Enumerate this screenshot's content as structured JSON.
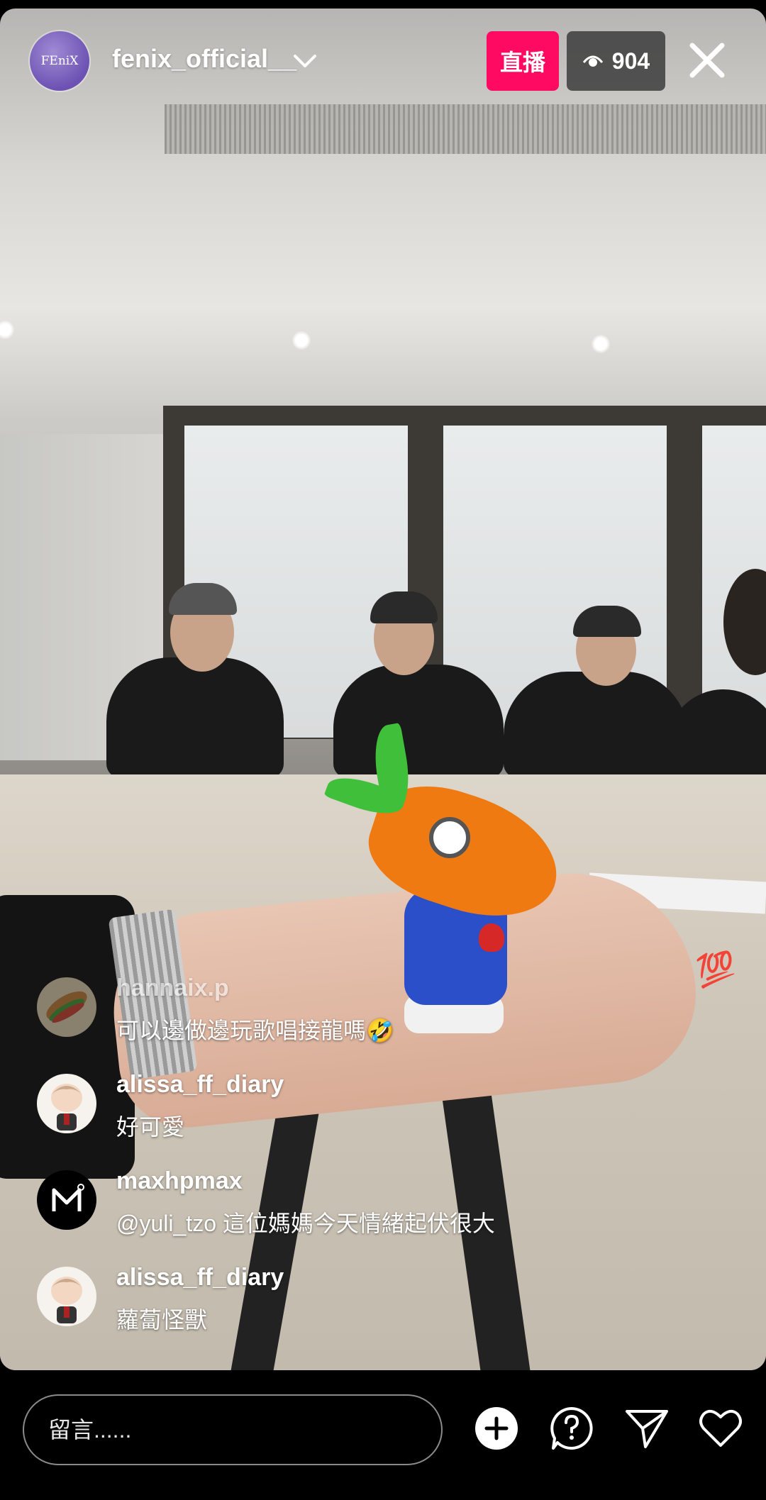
{
  "header": {
    "avatar_text": "FEniX",
    "username": "fenix_official__",
    "live_label": "直播",
    "viewer_count": "904"
  },
  "comments": [
    {
      "username": "hannaix.p",
      "text": "可以邊做邊玩歌唱接龍嗎🤣",
      "avatar": "sandwich-avatar"
    },
    {
      "username": "alissa_ff_diary",
      "text": "好可愛",
      "avatar": "cartoon-boy-avatar"
    },
    {
      "username": "maxhpmax",
      "text": "@yuli_tzo 這位媽媽今天情緒起伏很大",
      "avatar": "m-logo-avatar"
    },
    {
      "username": "alissa_ff_diary",
      "text": "蘿蔔怪獸",
      "avatar": "cartoon-boy-avatar"
    }
  ],
  "reaction": "💯",
  "input": {
    "placeholder": "留言......"
  },
  "colors": {
    "live_badge": "#ff0a62",
    "viewer_badge": "#3c3c3c",
    "background": "#000000"
  },
  "icons": [
    "chevron-down-icon",
    "eye-icon",
    "close-icon",
    "add-icon",
    "question-icon",
    "send-icon",
    "heart-icon"
  ]
}
